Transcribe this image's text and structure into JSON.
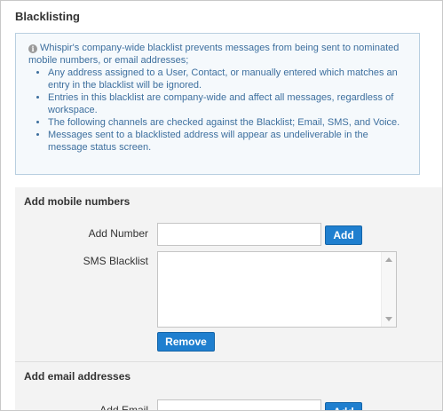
{
  "page": {
    "title": "Blacklisting"
  },
  "info": {
    "icon": "info-circle-icon",
    "intro": "Whispir's company-wide blacklist prevents messages from being sent to nominated mobile numbers, or email addresses;",
    "bullets": [
      "Any address assigned to a User, Contact, or manually entered which matches an entry in the blacklist will be ignored.",
      "Entries in this blacklist are company-wide and affect all messages, regardless of workspace.",
      "The following channels are checked against the Blacklist; Email, SMS, and Voice.",
      "Messages sent to a blacklisted address will appear as undeliverable in the message status screen."
    ]
  },
  "mobile_section": {
    "heading": "Add mobile numbers",
    "add_number_label": "Add Number",
    "add_number_value": "",
    "add_button": "Add",
    "sms_blacklist_label": "SMS Blacklist",
    "sms_blacklist_value": "",
    "remove_button": "Remove"
  },
  "email_section": {
    "heading": "Add email addresses",
    "add_email_label": "Add Email",
    "add_email_value": "",
    "add_button": "Add"
  },
  "colors": {
    "accent": "#1f7fcf",
    "info_text": "#3d6f9e",
    "info_border": "#b9cfe0",
    "section_bg": "#f3f3f3"
  }
}
